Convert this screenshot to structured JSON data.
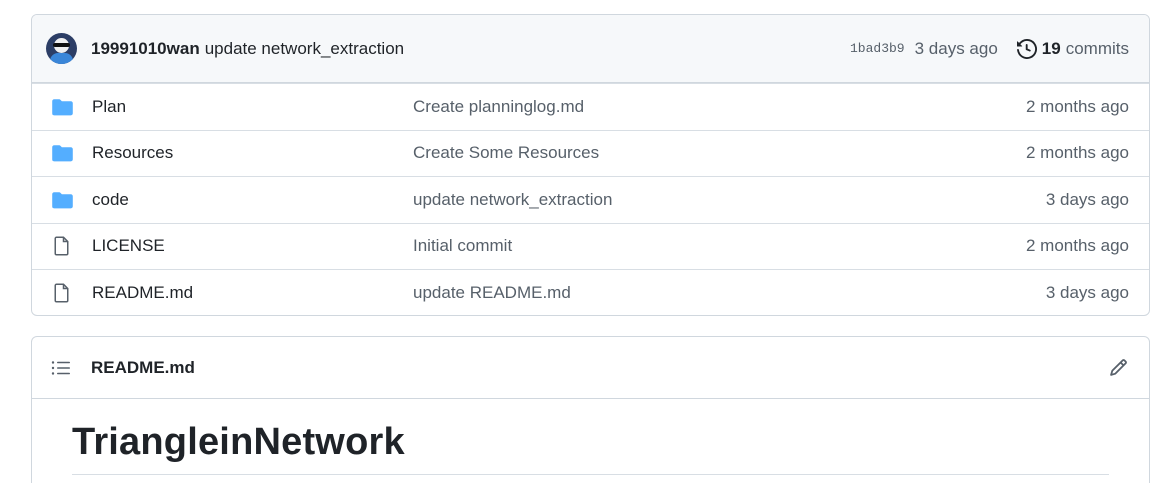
{
  "latest_commit": {
    "author": "19991010wan",
    "message": "update network_extraction",
    "sha": "1bad3b9",
    "time": "3 days ago",
    "commits_count": "19",
    "commits_label": "commits"
  },
  "files": [
    {
      "name": "Plan",
      "type": "folder",
      "commit": "Create planninglog.md",
      "time": "2 months ago"
    },
    {
      "name": "Resources",
      "type": "folder",
      "commit": "Create Some Resources",
      "time": "2 months ago"
    },
    {
      "name": "code",
      "type": "folder",
      "commit": "update network_extraction",
      "time": "3 days ago"
    },
    {
      "name": "LICENSE",
      "type": "file",
      "commit": "Initial commit",
      "time": "2 months ago"
    },
    {
      "name": "README.md",
      "type": "file",
      "commit": "update README.md",
      "time": "3 days ago"
    }
  ],
  "readme": {
    "filename": "README.md",
    "heading": "TriangleinNetwork"
  },
  "colors": {
    "folder": "#54aeff",
    "file_icon": "#57606a",
    "border": "#d0d7de"
  }
}
